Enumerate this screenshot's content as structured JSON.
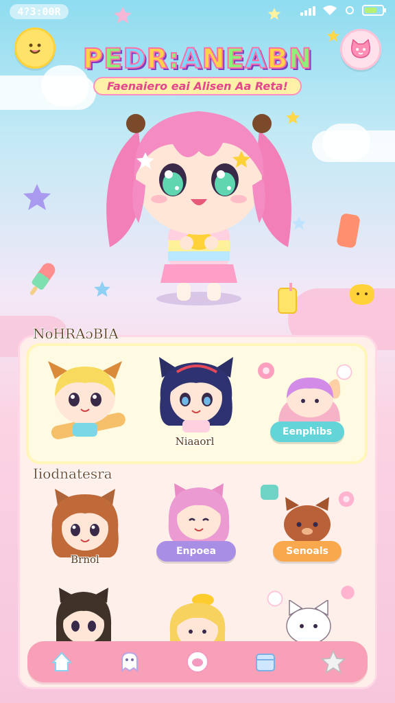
{
  "status_bar": {
    "time": "4?3:00R"
  },
  "header": {
    "title": "PEDR:ANEABN",
    "subtitle": "Faenaiero eai Alisen Aa Reta!"
  },
  "sections": [
    {
      "label": "NoHRAɔBIA"
    },
    {
      "label": "Iiodnatesra"
    }
  ],
  "featured": [
    {
      "name": ""
    },
    {
      "name": "Niaaorl"
    },
    {
      "button": "Eenphibs"
    }
  ],
  "grid": [
    {
      "name": "Brnol"
    },
    {
      "button": "Enpoea"
    },
    {
      "button": "Senoals"
    }
  ],
  "icons": {
    "top_left": "smile-face-icon",
    "top_right": "cat-face-icon",
    "nav": [
      "home-icon",
      "ghost-icon",
      "chat-icon",
      "shop-icon",
      "star-icon"
    ]
  },
  "colors": {
    "pill_teal": "#63d4d8",
    "pill_purple": "#a98ee6",
    "pill_orange": "#f9a84e",
    "navbar": "#f7a0b8"
  }
}
